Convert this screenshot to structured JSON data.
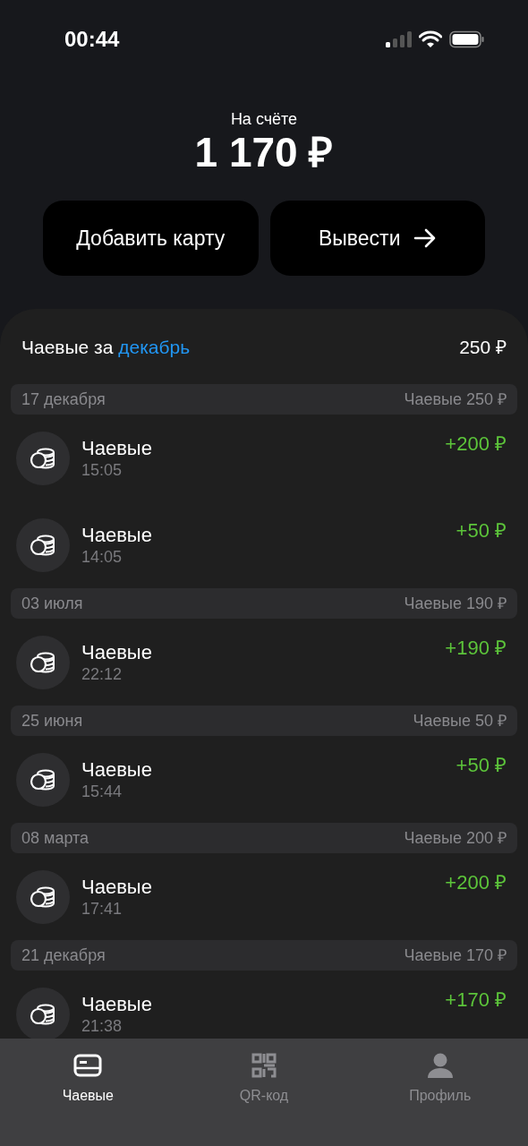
{
  "status_bar": {
    "time": "00:44"
  },
  "balance": {
    "label": "На счёте",
    "amount": "1 170 ₽"
  },
  "actions": [
    {
      "label": "Добавить карту",
      "kind": "plain"
    },
    {
      "label": "Вывести",
      "kind": "arrow"
    }
  ],
  "period": {
    "label": "Чаевые за",
    "month": "декабрь",
    "total": "250 ₽"
  },
  "groups": [
    {
      "date": "17 декабря",
      "summary": "Чаевые 250 ₽",
      "items": [
        {
          "title": "Чаевые",
          "time": "15:05",
          "amount": "+200 ₽"
        },
        {
          "title": "Чаевые",
          "time": "14:05",
          "amount": "+50 ₽"
        }
      ]
    },
    {
      "date": "03 июля",
      "summary": "Чаевые 190 ₽",
      "items": [
        {
          "title": "Чаевые",
          "time": "22:12",
          "amount": "+190 ₽"
        }
      ]
    },
    {
      "date": "25 июня",
      "summary": "Чаевые 50 ₽",
      "items": [
        {
          "title": "Чаевые",
          "time": "15:44",
          "amount": "+50 ₽"
        }
      ]
    },
    {
      "date": "08 марта",
      "summary": "Чаевые 200 ₽",
      "items": [
        {
          "title": "Чаевые",
          "time": "17:41",
          "amount": "+200 ₽"
        }
      ]
    },
    {
      "date": "21 декабря",
      "summary": "Чаевые 170 ₽",
      "items": [
        {
          "title": "Чаевые",
          "time": "21:38",
          "amount": "+170 ₽"
        }
      ]
    }
  ],
  "tabs": [
    {
      "label": "Чаевые",
      "kind": "card",
      "selected": true
    },
    {
      "label": "QR-код",
      "kind": "qr",
      "selected": false
    },
    {
      "label": "Профиль",
      "kind": "profile",
      "selected": false
    }
  ]
}
